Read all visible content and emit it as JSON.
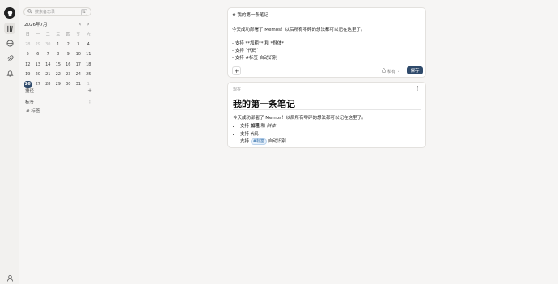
{
  "rail": {
    "icons": [
      "memos-logo-icon",
      "home-icon",
      "explore-icon",
      "attachment-icon",
      "bell-icon",
      "user-icon"
    ]
  },
  "sidebar": {
    "search_placeholder": "搜索备忘录",
    "search_shortcut_icon": "filter-icon",
    "calendar": {
      "month": "2026年7月",
      "weekdays": [
        "日",
        "一",
        "二",
        "三",
        "四",
        "五",
        "六"
      ],
      "weeks": [
        [
          "28",
          "29",
          "30",
          "1",
          "2",
          "3",
          "4"
        ],
        [
          "5",
          "6",
          "7",
          "8",
          "9",
          "10",
          "11"
        ],
        [
          "12",
          "13",
          "14",
          "15",
          "16",
          "17",
          "18"
        ],
        [
          "19",
          "20",
          "21",
          "22",
          "23",
          "24",
          "25"
        ],
        [
          "26",
          "27",
          "28",
          "29",
          "30",
          "31",
          "1"
        ]
      ],
      "today": "26"
    },
    "shortcuts_label": "捷径",
    "tags_label": "标签",
    "tag_items": [
      "# 标签"
    ]
  },
  "editor": {
    "lines": [
      "# 我的第一条笔记",
      "",
      "今天成功部署了 Memos！以后所有零碎的想法都可以记在这里了。",
      "",
      "- 支持 **加粗** 和 *斜体*",
      "- 支持 `代码`",
      "- 支持 #标签 自动识别"
    ],
    "visibility": "私有",
    "save_label": "保存"
  },
  "memo": {
    "time": "现在",
    "title": "我的第一条笔记",
    "paragraph": "今天成功部署了 Memos！以后所有零碎的想法都可以记在这里了。",
    "item1_prefix": "支持 ",
    "item1_bold": "加粗",
    "item1_mid": " 和 ",
    "item1_italic": "斜体",
    "item2_prefix": "支持 ",
    "item2_code": "代码",
    "item3_prefix": "支持 ",
    "item3_tag": "#标签",
    "item3_suffix": " 自动识别"
  },
  "colors": {
    "accent": "#2f4a6b",
    "tag": "#2f6da8",
    "background": "#f6f5f4"
  }
}
